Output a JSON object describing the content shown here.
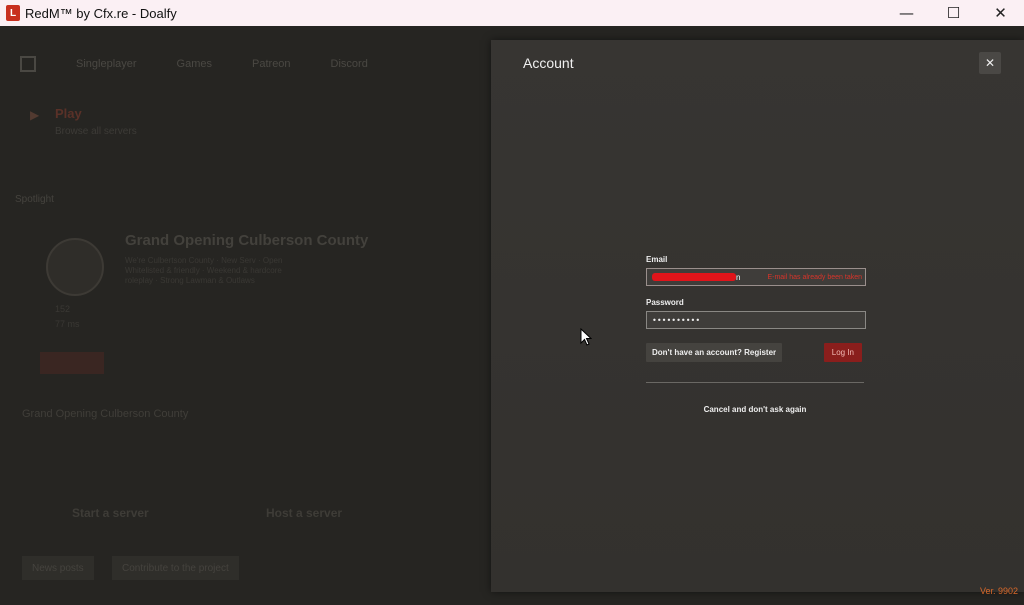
{
  "window": {
    "logo_text": "L",
    "title": "RedM™ by Cfx.re - Doalfy",
    "minimize_glyph": "—",
    "maximize_glyph": "☐",
    "close_glyph": "✕"
  },
  "background": {
    "nav": [
      "Singleplayer",
      "Games",
      "Patreon",
      "Discord"
    ],
    "play_title": "Play",
    "play_subtitle": "Browse all servers",
    "spotlight_label": "Spotlight",
    "server_title": "Grand Opening Culberson County",
    "server_desc": "We're Culbertson County · New Serv · Open Whitelisted & friendly · Weekend & hardcore roleplay · Strong Lawman & Outlaws",
    "stat_players": "152",
    "stat_ping": "77 ms",
    "row_title": "Grand Opening Culberson County",
    "start_server": "Start a server",
    "host_server": "Host a server",
    "btn_news": "News posts",
    "btn_contribute": "Contribute to the project"
  },
  "modal": {
    "title": "Account",
    "close_glyph": "✕",
    "email_label": "Email",
    "email_tail": "n",
    "email_error": "E-mail has already been taken",
    "password_label": "Password",
    "password_value": "••••••••••",
    "register_label": "Don't have an account? Register",
    "login_label": "Log In",
    "cancel_label": "Cancel and don't ask again"
  },
  "version": "Ver. 9902",
  "colors": {
    "accent": "#8a1e1c",
    "error": "#d8342a",
    "version": "#d8682a"
  }
}
